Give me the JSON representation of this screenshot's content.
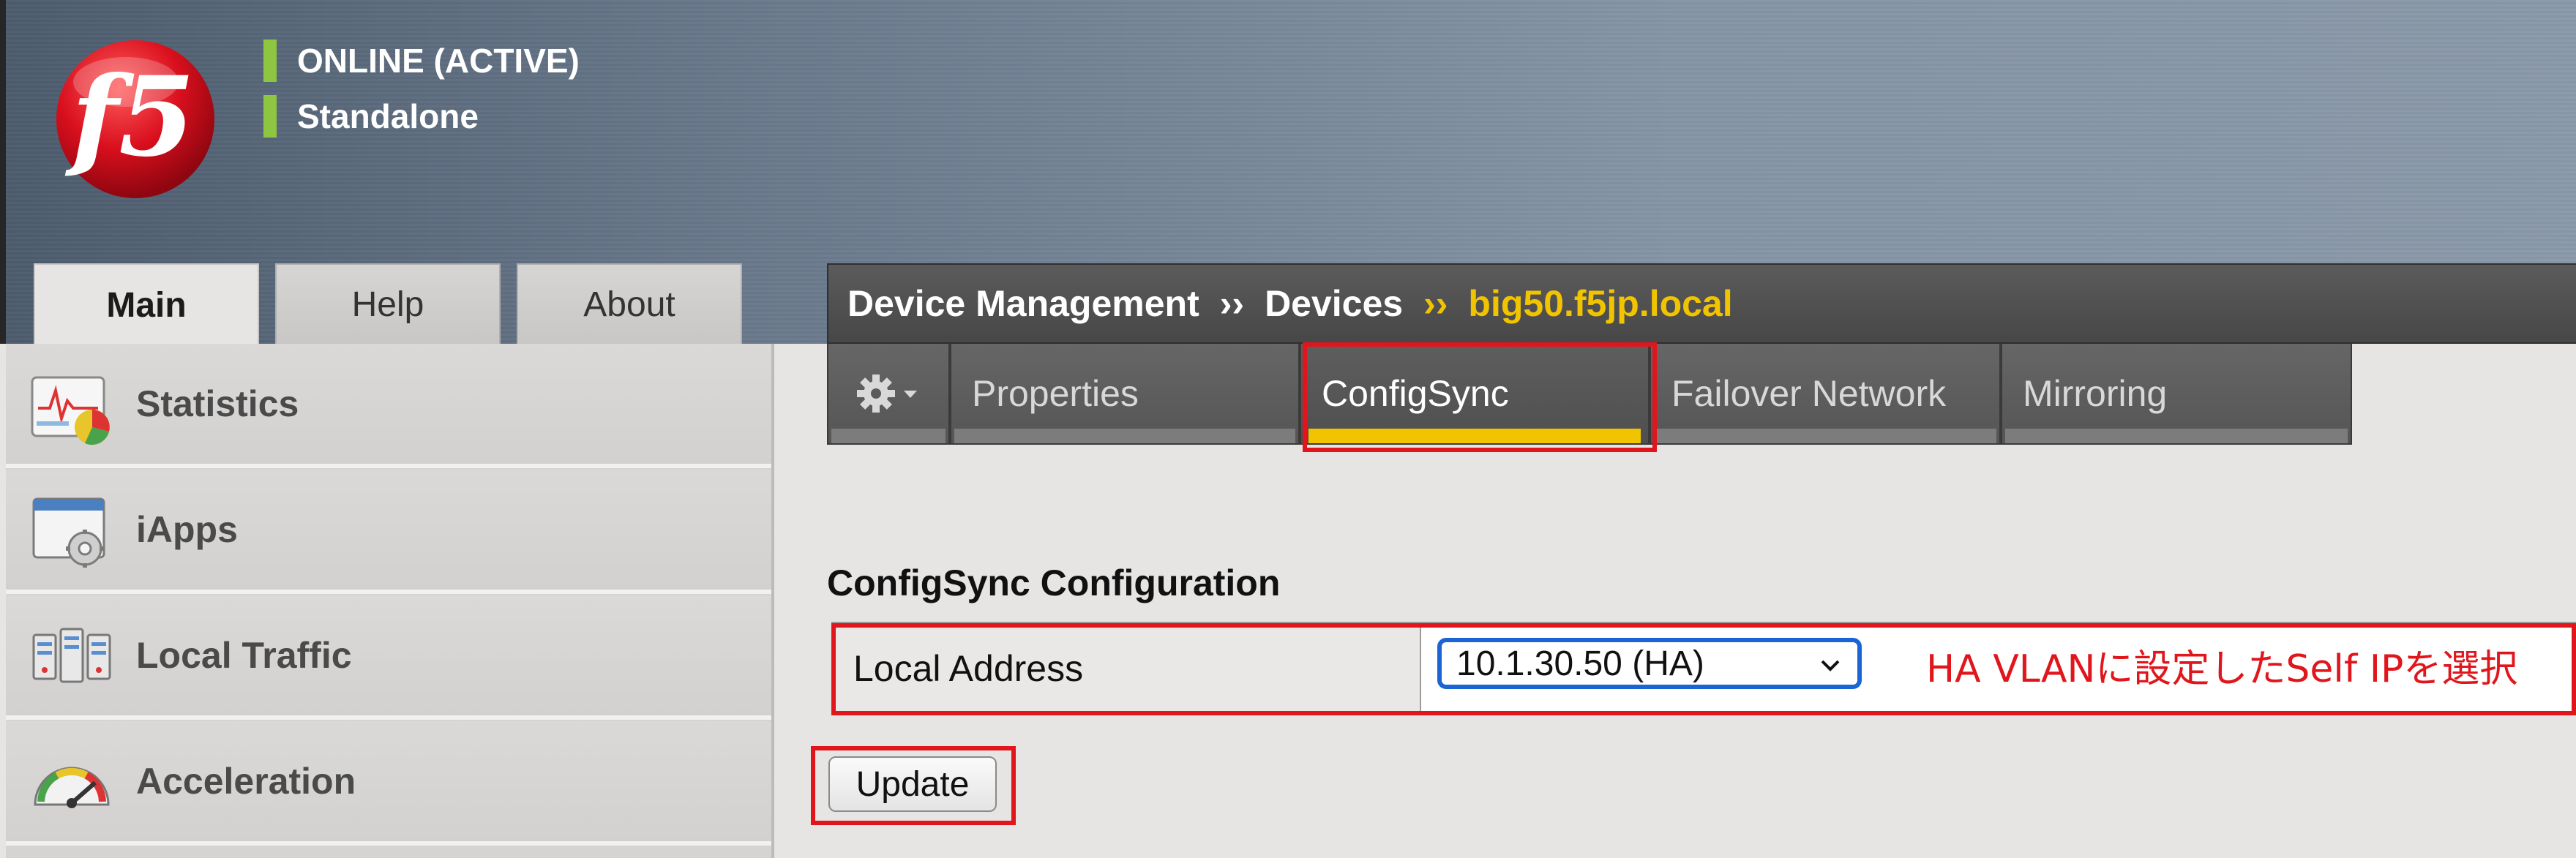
{
  "header": {
    "logo_text": "f5",
    "status_line_1": "ONLINE (ACTIVE)",
    "status_line_2": "Standalone"
  },
  "left_tabs": [
    "Main",
    "Help",
    "About"
  ],
  "nav": {
    "items": [
      {
        "label": "Statistics",
        "icon": "statistics-icon"
      },
      {
        "label": "iApps",
        "icon": "iapps-icon"
      },
      {
        "label": "Local Traffic",
        "icon": "local-traffic-icon"
      },
      {
        "label": "Acceleration",
        "icon": "acceleration-icon"
      }
    ]
  },
  "breadcrumb": {
    "part1": "Device Management",
    "sep": "››",
    "part2": "Devices",
    "current": "big50.f5jp.local"
  },
  "tabs": [
    "Properties",
    "ConfigSync",
    "Failover Network",
    "Mirroring"
  ],
  "active_tab": "ConfigSync",
  "form": {
    "section_title": "ConfigSync Configuration",
    "local_address_label": "Local Address",
    "local_address_value": "10.1.30.50 (HA)",
    "annotation": "HA VLANに設定したSelf IPを選択",
    "update_label": "Update"
  },
  "colors": {
    "accent_yellow": "#f2c400",
    "status_green": "#8fc641",
    "highlight_red": "#e0161c",
    "select_blue": "#1a64d6"
  }
}
